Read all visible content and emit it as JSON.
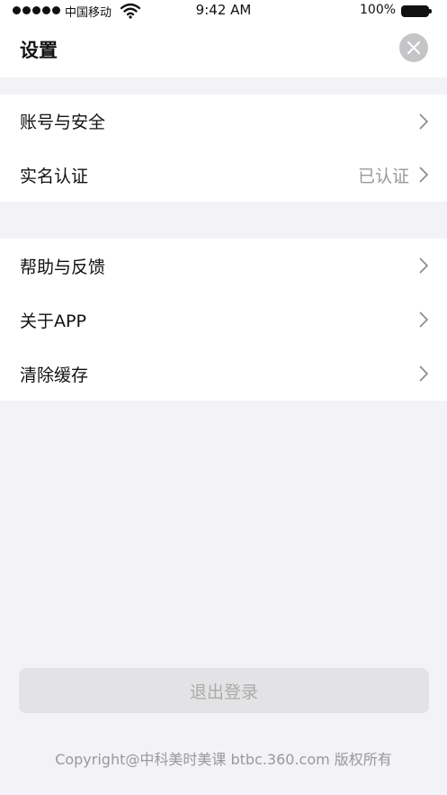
{
  "status_bar": {
    "carrier": "中国移动",
    "time": "9:42 AM",
    "battery": "100%"
  },
  "header": {
    "title": "设置",
    "close_icon": "close-icon"
  },
  "settings": {
    "group1": [
      {
        "label": "账号与安全",
        "value": ""
      },
      {
        "label": "实名认证",
        "value": "已认证"
      }
    ],
    "group2": [
      {
        "label": "帮助与反馈",
        "value": ""
      },
      {
        "label": "关于APP",
        "value": ""
      },
      {
        "label": "清除缓存",
        "value": ""
      }
    ]
  },
  "logout_label": "退出登录",
  "copyright": "Copyright@中科美时美课 btbc.360.com 版权所有",
  "colors": {
    "background": "#f3f3f7",
    "muted_text": "#999999",
    "button_bg": "#e3e3e5"
  }
}
